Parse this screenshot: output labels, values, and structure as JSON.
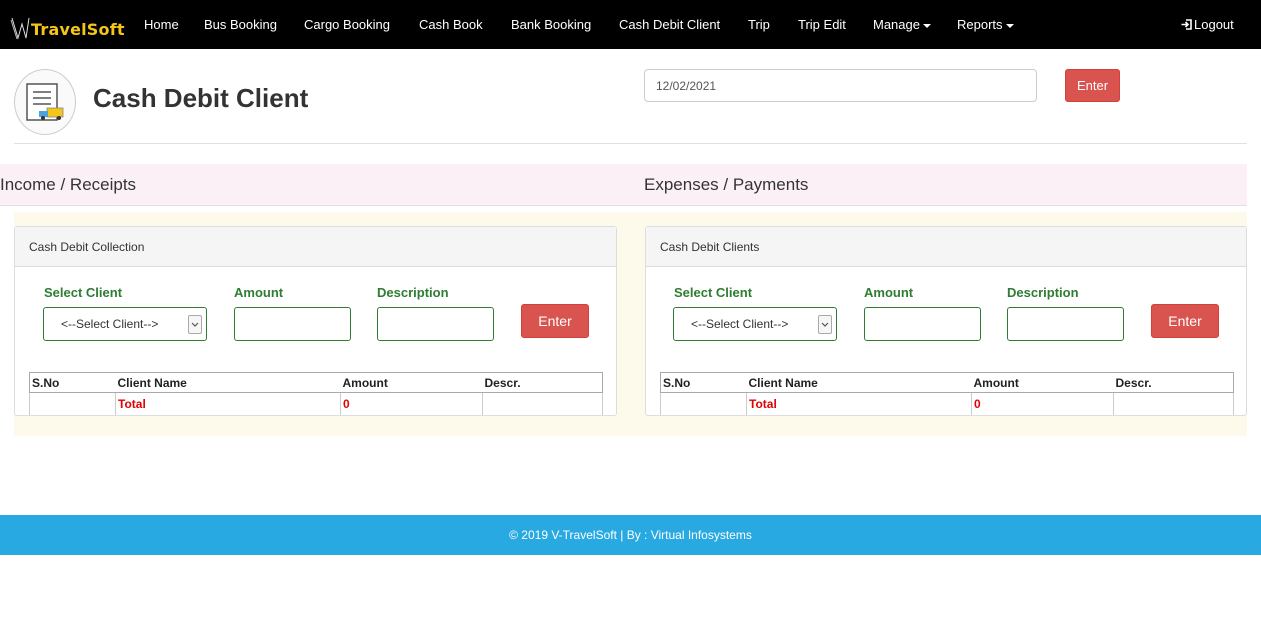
{
  "brand": {
    "name": "TravelSoft"
  },
  "nav": {
    "items": [
      "Home",
      "Bus Booking",
      "Cargo Booking",
      "Cash Book",
      "Bank Booking",
      "Cash Debit Client",
      "Trip",
      "Trip Edit"
    ],
    "dropdowns": [
      "Manage",
      "Reports"
    ],
    "logout": "Logout"
  },
  "page": {
    "title": "Cash Debit Client",
    "date": "12/02/2021",
    "enter_label": "Enter"
  },
  "income": {
    "section_title": "Income / Receipts",
    "panel_title": "Cash Debit Collection",
    "labels": {
      "client": "Select Client",
      "amount": "Amount",
      "description": "Description"
    },
    "select_value": "<--Select Client-->",
    "enter_label": "Enter",
    "table": {
      "headers": [
        "S.No",
        "Client Name",
        "Amount",
        "Descr."
      ],
      "total_label": "Total",
      "total_value": "0"
    }
  },
  "expense": {
    "section_title": "Expenses / Payments",
    "panel_title": "Cash Debit Clients",
    "labels": {
      "client": "Select Client",
      "amount": "Amount",
      "description": "Description"
    },
    "select_value": "<--Select Client-->",
    "enter_label": "Enter",
    "table": {
      "headers": [
        "S.No",
        "Client Name",
        "Amount",
        "Descr."
      ],
      "total_label": "Total",
      "total_value": "0"
    }
  },
  "footer": {
    "text": "© 2019 V-TravelSoft | By : Virtual Infosystems"
  },
  "colors": {
    "navbar": "#000000",
    "brand": "#f5c518",
    "accent_red": "#d9534f",
    "label_green": "#2e7d32",
    "footer": "#29a9e1",
    "total_red": "#e00000"
  }
}
